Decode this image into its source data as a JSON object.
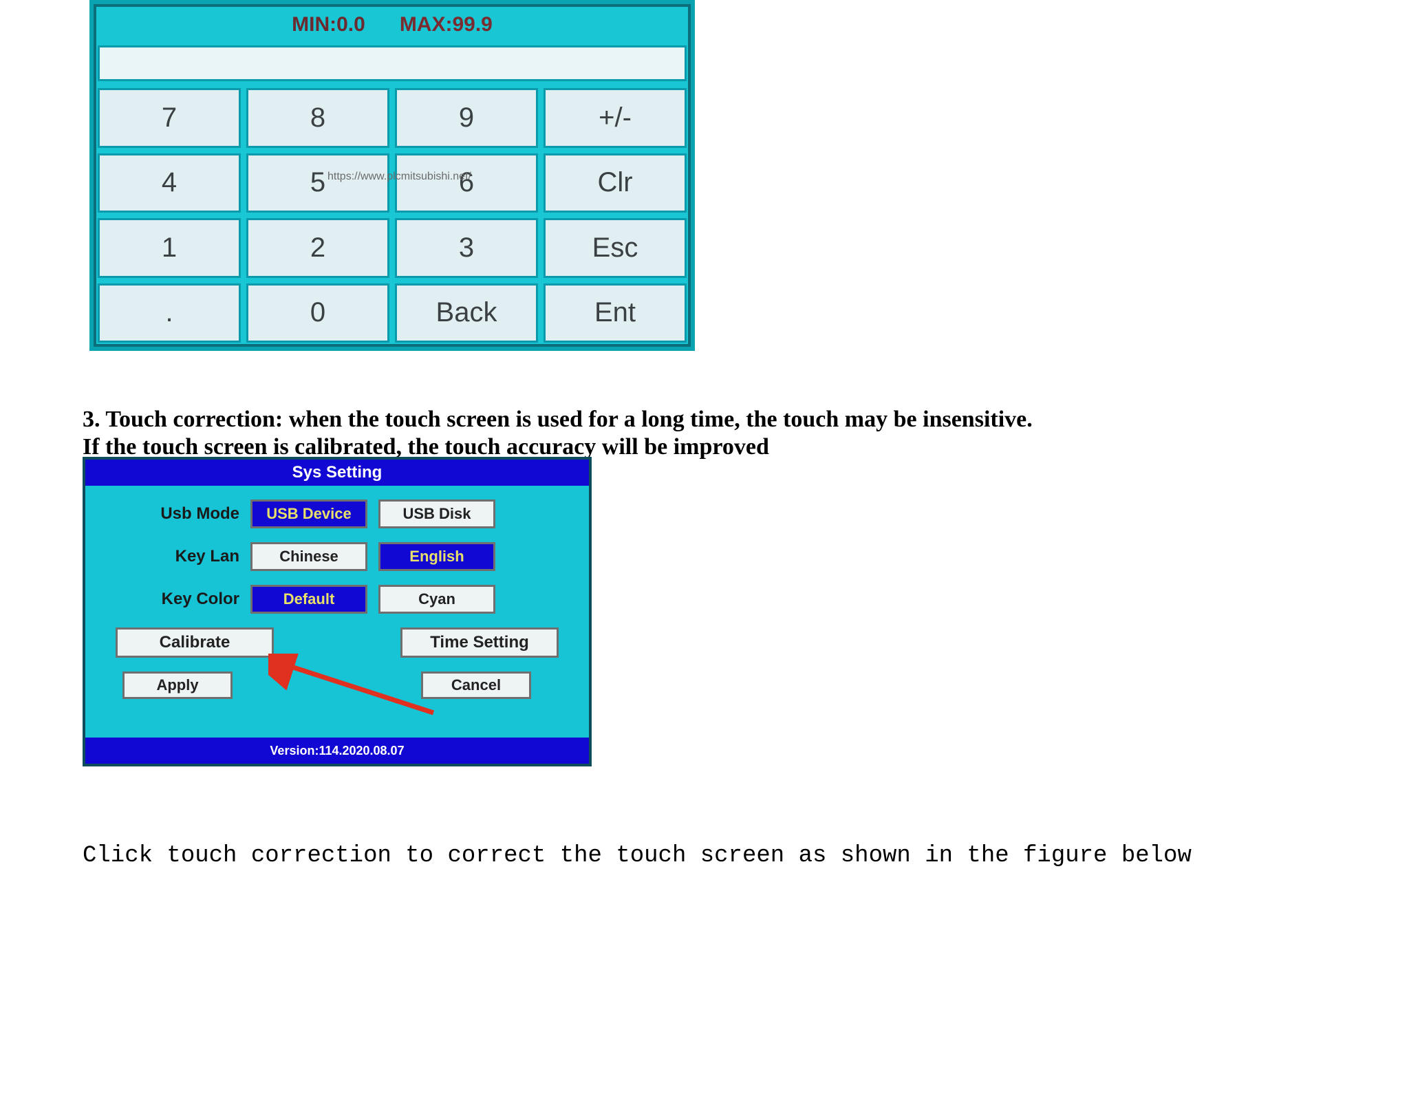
{
  "keypad": {
    "min_label": "MIN:0.0",
    "max_label": "MAX:99.9",
    "watermark": "https://www.plcmitsubishi.net/",
    "keys": [
      "7",
      "8",
      "9",
      "+/-",
      "4",
      "5",
      "6",
      "Clr",
      "1",
      "2",
      "3",
      "Esc",
      ".",
      "0",
      "Back",
      "Ent"
    ]
  },
  "section3_line1": "3. Touch correction: when the touch screen is used for a long time, the touch may be insensitive.",
  "section3_line2": "If the touch screen is calibrated, the touch accuracy will be improved",
  "sys": {
    "title": "Sys Setting",
    "rows": {
      "usb_mode": {
        "label": "Usb Mode",
        "opt1": "USB Device",
        "opt2": "USB Disk"
      },
      "key_lan": {
        "label": "Key Lan",
        "opt1": "Chinese",
        "opt2": "English"
      },
      "key_color": {
        "label": "Key Color",
        "opt1": "Default",
        "opt2": "Cyan"
      }
    },
    "calibrate": "Calibrate",
    "time_setting": "Time Setting",
    "apply": "Apply",
    "cancel": "Cancel",
    "version": "Version:114.2020.08.07"
  },
  "bottom_line": "Click touch correction to correct the touch screen as shown in the figure below"
}
